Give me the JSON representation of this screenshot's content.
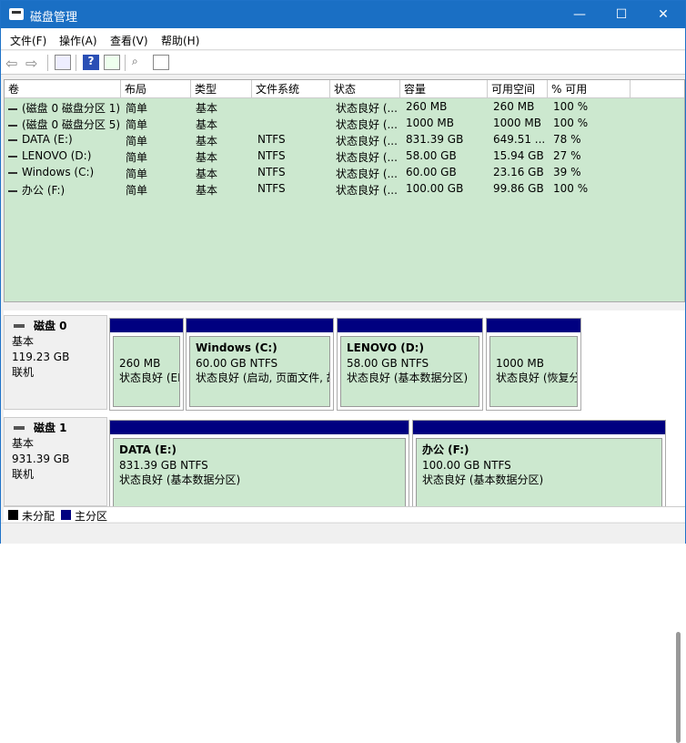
{
  "window": {
    "title": "磁盘管理",
    "minimize": "—",
    "maximize": "☐",
    "close": "✕"
  },
  "menu": [
    "文件(F)",
    "操作(A)",
    "查看(V)",
    "帮助(H)"
  ],
  "columns": [
    "卷",
    "布局",
    "类型",
    "文件系统",
    "状态",
    "容量",
    "可用空间",
    "% 可用"
  ],
  "volumes": [
    {
      "name": "(磁盘 0 磁盘分区 1)",
      "layout": "简单",
      "type": "基本",
      "fs": "",
      "status": "状态良好 (...",
      "capacity": "260 MB",
      "free": "260 MB",
      "pct": "100 %"
    },
    {
      "name": "(磁盘 0 磁盘分区 5)",
      "layout": "简单",
      "type": "基本",
      "fs": "",
      "status": "状态良好 (...",
      "capacity": "1000 MB",
      "free": "1000 MB",
      "pct": "100 %"
    },
    {
      "name": "DATA (E:)",
      "layout": "简单",
      "type": "基本",
      "fs": "NTFS",
      "status": "状态良好 (...",
      "capacity": "831.39 GB",
      "free": "649.51 ...",
      "pct": "78 %"
    },
    {
      "name": "LENOVO (D:)",
      "layout": "简单",
      "type": "基本",
      "fs": "NTFS",
      "status": "状态良好 (...",
      "capacity": "58.00 GB",
      "free": "15.94 GB",
      "pct": "27 %"
    },
    {
      "name": "Windows (C:)",
      "layout": "简单",
      "type": "基本",
      "fs": "NTFS",
      "status": "状态良好 (...",
      "capacity": "60.00 GB",
      "free": "23.16 GB",
      "pct": "39 %"
    },
    {
      "name": "办公 (F:)",
      "layout": "简单",
      "type": "基本",
      "fs": "NTFS",
      "status": "状态良好 (...",
      "capacity": "100.00 GB",
      "free": "99.86 GB",
      "pct": "100 %"
    }
  ],
  "disks": [
    {
      "name": "磁盘 0",
      "type": "基本",
      "size": "119.23 GB",
      "state": "联机",
      "partitions": [
        {
          "title": "",
          "size": "260 MB",
          "status": "状态良好 (EFI 系统分区)"
        },
        {
          "title": "Windows  (C:)",
          "size": "60.00 GB NTFS",
          "status": "状态良好 (启动, 页面文件, 故障转储, 基本数据分区)"
        },
        {
          "title": "LENOVO  (D:)",
          "size": "58.00 GB NTFS",
          "status": "状态良好 (基本数据分区)"
        },
        {
          "title": "",
          "size": "1000 MB",
          "status": "状态良好 (恢复分区)"
        }
      ]
    },
    {
      "name": "磁盘 1",
      "type": "基本",
      "size": "931.39 GB",
      "state": "联机",
      "partitions": [
        {
          "title": "DATA  (E:)",
          "size": "831.39 GB NTFS",
          "status": "状态良好 (基本数据分区)"
        },
        {
          "title": "办公  (F:)",
          "size": "100.00 GB NTFS",
          "status": "状态良好 (基本数据分区)"
        }
      ]
    }
  ],
  "legend": {
    "unallocated": "未分配",
    "primary": "主分区",
    "unallocated_color": "#000000",
    "primary_color": "#000080"
  }
}
